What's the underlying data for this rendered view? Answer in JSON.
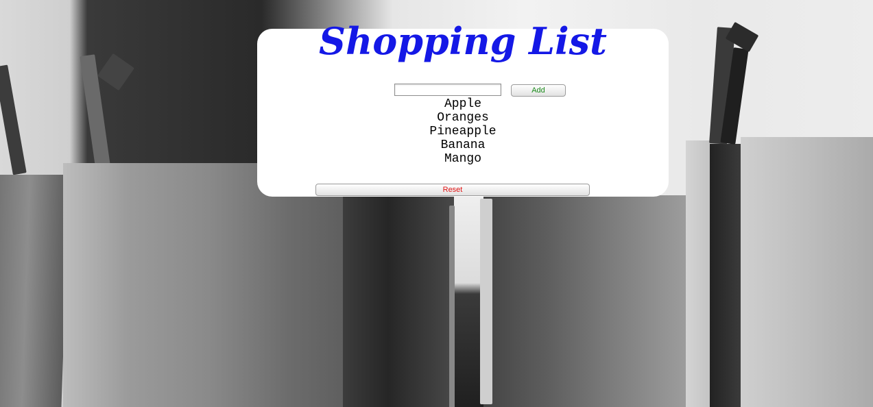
{
  "page": {
    "title": "Shopping List",
    "title_color": "#1418e6"
  },
  "add_form": {
    "input_value": "",
    "input_placeholder": "",
    "add_label": "Add",
    "add_color": "#1a8a1a"
  },
  "list": {
    "items": [
      "Apple",
      "Oranges",
      "Pineapple",
      "Banana",
      "Mango"
    ]
  },
  "reset": {
    "label": "Reset",
    "color": "#e01414"
  },
  "background": {
    "description_icon": "paper-bags-photo"
  }
}
